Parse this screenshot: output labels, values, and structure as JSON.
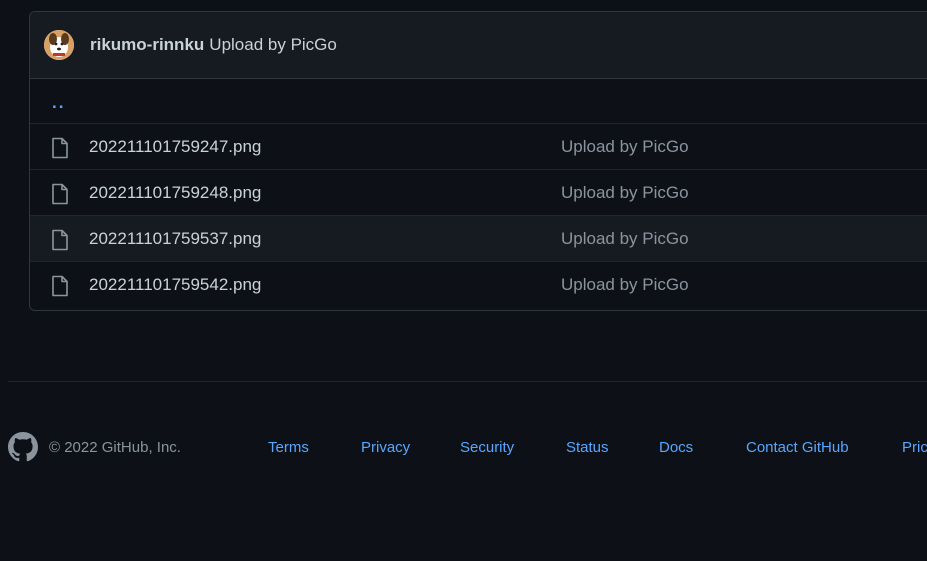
{
  "colors": {
    "background": "#0d1117",
    "header_bg": "#161b22",
    "border": "#30363d",
    "text": "#c9d1d9",
    "muted": "#8b949e",
    "link": "#58a6ff"
  },
  "commit": {
    "author": "rikumo-rinnku",
    "message": "Upload by PicGo",
    "avatar_icon": "user-avatar"
  },
  "parent_dir": "..",
  "files": [
    {
      "name": "202211101759247.png",
      "commit_message": "Upload by PicGo",
      "icon": "file-icon"
    },
    {
      "name": "202211101759248.png",
      "commit_message": "Upload by PicGo",
      "icon": "file-icon"
    },
    {
      "name": "202211101759537.png",
      "commit_message": "Upload by PicGo",
      "icon": "file-icon"
    },
    {
      "name": "202211101759542.png",
      "commit_message": "Upload by PicGo",
      "icon": "file-icon"
    }
  ],
  "footer": {
    "logo_icon": "github-mark-icon",
    "copyright": "© 2022 GitHub, Inc.",
    "links": [
      "Terms",
      "Privacy",
      "Security",
      "Status",
      "Docs",
      "Contact GitHub",
      "Pric"
    ]
  }
}
